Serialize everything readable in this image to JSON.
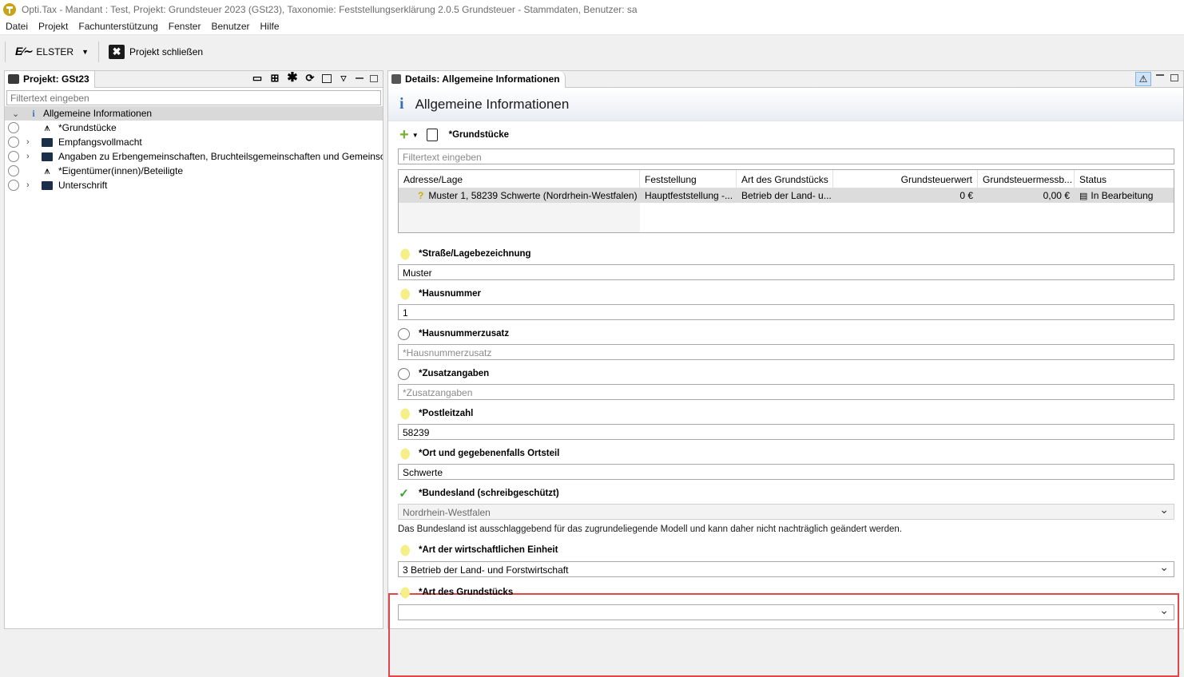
{
  "window": {
    "title": "Opti.Tax - Mandant : Test, Projekt: Grundsteuer 2023 (GSt23), Taxonomie: Feststellungserklärung 2.0.5 Grundsteuer - Stammdaten, Benutzer: sa"
  },
  "menu": [
    "Datei",
    "Projekt",
    "Fachunterstützung",
    "Fenster",
    "Benutzer",
    "Hilfe"
  ],
  "toolbar": {
    "elster_label": "ELSTER",
    "close_project_label": "Projekt schließen"
  },
  "project_panel": {
    "title": "Projekt: GSt23",
    "filter_placeholder": "Filtertext eingeben",
    "tree": [
      {
        "label": "Allgemeine Informationen",
        "icon": "info-icon"
      },
      {
        "label": "*Grundstücke",
        "icon": "hierarchy-icon"
      },
      {
        "label": "Empfangsvollmacht",
        "icon": "folder-icon"
      },
      {
        "label": "Angaben zu Erbengemeinschaften, Bruchteilsgemeinschaften und Gemeinsc",
        "icon": "folder-icon"
      },
      {
        "label": "*Eigentümer(innen)/Beteiligte",
        "icon": "hierarchy-icon"
      },
      {
        "label": "Unterschrift",
        "icon": "folder-icon"
      }
    ]
  },
  "details_panel": {
    "tab_title": "Details: Allgemeine Informationen",
    "header_title": "Allgemeine Informationen",
    "grundstuecke_label": "*Grundstücke",
    "filter_placeholder": "Filtertext eingeben",
    "table": {
      "columns": [
        "Adresse/Lage",
        "Feststellung",
        "Art des Grundstücks",
        "Grundsteuerwert",
        "Grundsteuermessb...",
        "Status"
      ],
      "rows": [
        [
          "Muster 1, 58239 Schwerte (Nordrhein-Westfalen)",
          "Hauptfeststellung -...",
          "Betrieb der Land- u...",
          "0 €",
          "0,00 €",
          "In Bearbeitung"
        ]
      ]
    },
    "fields": {
      "strasse": {
        "label": "*Straße/Lagebezeichnung",
        "value": "Muster"
      },
      "hausnummer": {
        "label": "*Hausnummer",
        "value": "1"
      },
      "hausnummerzusatz": {
        "label": "*Hausnummerzusatz",
        "placeholder": "*Hausnummerzusatz"
      },
      "zusatzangaben": {
        "label": "*Zusatzangaben",
        "placeholder": "*Zusatzangaben"
      },
      "postleitzahl": {
        "label": "*Postleitzahl",
        "value": "58239"
      },
      "ort": {
        "label": "*Ort und gegebenenfalls Ortsteil",
        "value": "Schwerte"
      },
      "bundesland": {
        "label": "*Bundesland (schreibgeschützt)",
        "value": "Nordrhein-Westfalen"
      },
      "bundesland_note": "Das Bundesland ist ausschlaggebend für das zugrundeliegende Modell und kann daher nicht nachträglich geändert werden.",
      "art_einheit": {
        "label": "*Art der wirtschaftlichen Einheit",
        "value": "3 Betrieb der Land- und Forstwirtschaft"
      },
      "art_grundstueck": {
        "label": "*Art des Grundstücks",
        "value": ""
      }
    }
  },
  "colors": {
    "highlight": "#e0464a",
    "info": "#3b6fb5",
    "accent_green": "#7ab032"
  }
}
